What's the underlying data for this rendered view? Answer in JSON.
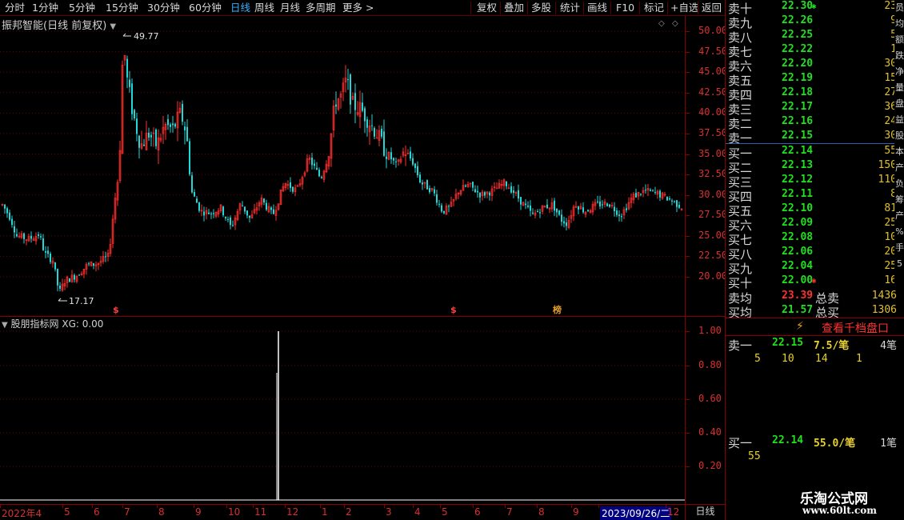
{
  "toolbar": {
    "left": [
      "分时",
      "1分钟",
      "5分钟",
      "15分钟",
      "30分钟",
      "60分钟",
      "日线",
      "周线",
      "月线",
      "多周期",
      "更多 >"
    ],
    "active": "日线",
    "right": [
      "复权",
      "叠加",
      "多股",
      "统计",
      "画线",
      "F10",
      "标记",
      "+自选",
      "返回"
    ]
  },
  "chart": {
    "title": "振邦智能(日线 前复权)",
    "high_label": "49.77",
    "low_label": "17.17",
    "markers": [
      "$",
      "$",
      "榜"
    ]
  },
  "indicator": {
    "title": "股朋指标网 XG: 0.00",
    "yticks": [
      "1.00",
      "0.80",
      "0.60",
      "0.40",
      "0.20"
    ]
  },
  "price_axis": [
    "50.00",
    "47.50",
    "45.00",
    "42.50",
    "40.00",
    "37.50",
    "35.00",
    "32.50",
    "30.00",
    "27.50",
    "25.00",
    "22.50",
    "20.00"
  ],
  "date_axis": {
    "labels": [
      "2022年4",
      "5",
      "6",
      "7",
      "8",
      "9",
      "10",
      "11",
      "12",
      "1",
      "2",
      "3",
      "4",
      "5",
      "6",
      "7",
      "8",
      "9",
      "2023/09/26/二",
      "12"
    ],
    "selected": "2023/09/26/二",
    "period": "日线"
  },
  "orderbook": {
    "asks": [
      {
        "label": "卖十",
        "price": "22.30",
        "vol": "23"
      },
      {
        "label": "卖九",
        "price": "22.26",
        "vol": "9"
      },
      {
        "label": "卖八",
        "price": "22.25",
        "vol": "5"
      },
      {
        "label": "卖七",
        "price": "22.22",
        "vol": "1"
      },
      {
        "label": "卖六",
        "price": "22.20",
        "vol": "30"
      },
      {
        "label": "卖五",
        "price": "22.19",
        "vol": "15"
      },
      {
        "label": "卖四",
        "price": "22.18",
        "vol": "27"
      },
      {
        "label": "卖三",
        "price": "22.17",
        "vol": "36"
      },
      {
        "label": "卖二",
        "price": "22.16",
        "vol": "24"
      },
      {
        "label": "卖一",
        "price": "22.15",
        "vol": "30"
      }
    ],
    "bids": [
      {
        "label": "买一",
        "price": "22.14",
        "vol": "55"
      },
      {
        "label": "买二",
        "price": "22.13",
        "vol": "150"
      },
      {
        "label": "买三",
        "price": "22.12",
        "vol": "110"
      },
      {
        "label": "买四",
        "price": "22.11",
        "vol": "8"
      },
      {
        "label": "买五",
        "price": "22.10",
        "vol": "81"
      },
      {
        "label": "买六",
        "price": "22.09",
        "vol": "25"
      },
      {
        "label": "买七",
        "price": "22.08",
        "vol": "10"
      },
      {
        "label": "买八",
        "price": "22.06",
        "vol": "20"
      },
      {
        "label": "买九",
        "price": "22.04",
        "vol": "25"
      },
      {
        "label": "买十",
        "price": "22.00",
        "vol": "16"
      }
    ],
    "ask_avg": {
      "label": "卖均",
      "price": "23.39",
      "total_label": "总卖",
      "total": "1436"
    },
    "bid_avg": {
      "label": "买均",
      "price": "21.57",
      "total_label": "总买",
      "total": "1306"
    }
  },
  "queue": {
    "link": "查看千档盘口",
    "sell1": {
      "label": "卖一",
      "price": "22.15",
      "avg": "7.5/笔",
      "count": "4笔",
      "orders": [
        "5",
        "10",
        "14",
        "1"
      ]
    },
    "buy1": {
      "label": "买一",
      "price": "22.14",
      "avg": "55.0/笔",
      "count": "1笔",
      "orders": [
        "55"
      ]
    }
  },
  "side_strip": [
    "员",
    "均",
    "额",
    "跌",
    "净",
    "量",
    "盘",
    "益",
    "股",
    "本",
    "产",
    "负",
    "筹",
    "产",
    "%",
    "手",
    "5"
  ],
  "watermark": {
    "text": "乐淘公式网",
    "url": "www.60lt.com"
  },
  "colors": {
    "up": "#ff3030",
    "down": "#20d8d8",
    "grid": "#8a0000",
    "active_tab": "#3ab0ff"
  },
  "icons": [
    "dropdown-icon",
    "diamond-icon",
    "lightning-icon"
  ]
}
